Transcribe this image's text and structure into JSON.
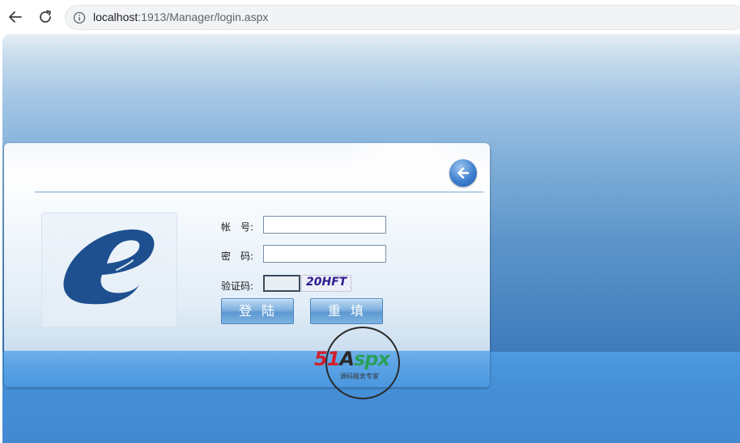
{
  "browser": {
    "url_host": "localhost",
    "url_rest": ":1913/Manager/login.aspx",
    "back_icon": "back-arrow-icon",
    "reload_icon": "reload-icon",
    "info_icon": "info-icon"
  },
  "login": {
    "account_label": "帐　号:",
    "password_label": "密　码:",
    "captcha_label": "验证码:",
    "account_value": "",
    "password_value": "",
    "captcha_value": "",
    "captcha_text": "20HFT",
    "login_button": "登陆",
    "reset_button": "重填",
    "back_icon": "back-circle-arrow-icon",
    "logo_icon": "e-logo-icon"
  },
  "watermark": {
    "brand_num": "51",
    "brand_a": "A",
    "brand_spx": "spx",
    "tagline": "源码服务专家"
  },
  "colors": {
    "brand_red": "#d0202a",
    "brand_green": "#2aa05a",
    "logo_blue": "#1e4f8f",
    "bg_blue": "#3f7cbc"
  }
}
